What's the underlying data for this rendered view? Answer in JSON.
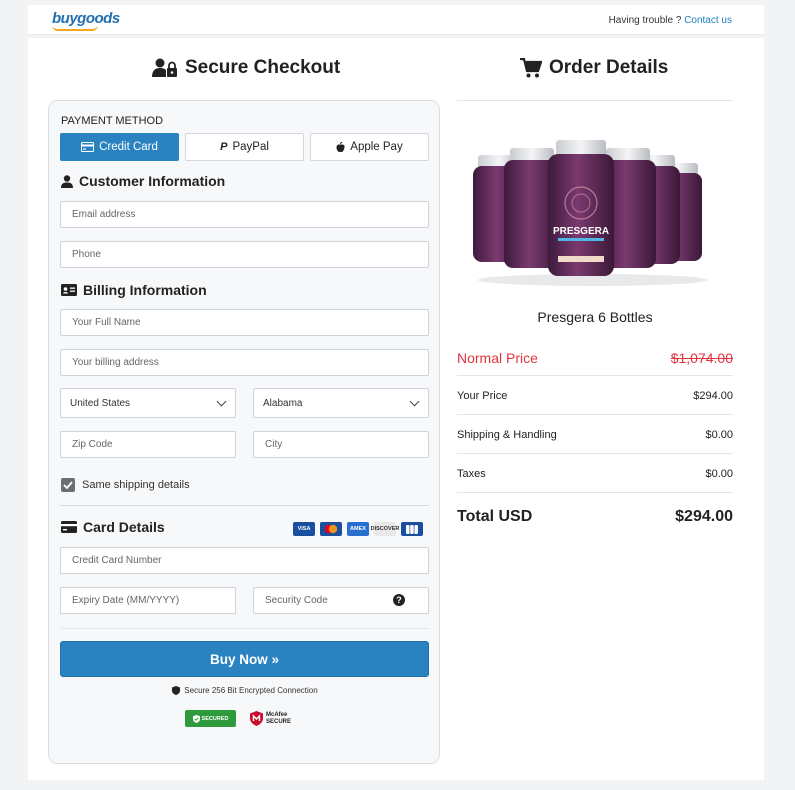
{
  "header": {
    "logo_text": "buygoods",
    "trouble_text": "Having trouble ?",
    "contact_link": "Contact us"
  },
  "checkout": {
    "title": "Secure Checkout",
    "payment_method_label": "PAYMENT METHOD",
    "tabs": [
      {
        "label": "Credit Card",
        "icon": "credit-card-icon",
        "active": true
      },
      {
        "label": "PayPal",
        "icon": "paypal-icon",
        "active": false
      },
      {
        "label": "Apple Pay",
        "icon": "apple-icon",
        "active": false
      }
    ],
    "customer_info": {
      "title": "Customer Information",
      "email_placeholder": "Email address",
      "phone_placeholder": "Phone"
    },
    "billing_info": {
      "title": "Billing Information",
      "name_placeholder": "Your Full Name",
      "address_placeholder": "Your billing address",
      "country_value": "United States",
      "state_value": "Alabama",
      "zip_placeholder": "Zip Code",
      "city_placeholder": "City",
      "same_shipping_label": "Same shipping details",
      "same_shipping_checked": true
    },
    "card_details": {
      "title": "Card Details",
      "card_brands": [
        "VISA",
        "mastercard",
        "AMEX",
        "DISCOVER",
        "jcb"
      ],
      "number_placeholder": "Credit Card Number",
      "expiry_placeholder": "Expiry Date (MM/YYYY)",
      "cvv_placeholder": "Security Code"
    },
    "buy_button": "Buy Now »",
    "secure_text": "Secure 256 Bit Encrypted Connection",
    "badge_secured": "SECURED",
    "badge_mcafee_top": "McAfee",
    "badge_mcafee_bottom": "SECURE"
  },
  "order": {
    "title": "Order Details",
    "product_name": "Presgera 6 Bottles",
    "product_label": "PRESGERA",
    "rows": [
      {
        "label": "Normal Price",
        "value": "$1,074.00"
      },
      {
        "label": "Your Price",
        "value": "$294.00"
      },
      {
        "label": "Shipping & Handling",
        "value": "$0.00"
      },
      {
        "label": "Taxes",
        "value": "$0.00"
      }
    ],
    "total_label": "Total USD",
    "total_value": "$294.00"
  },
  "colors": {
    "accent": "#2a82c0",
    "normal_price": "#e0343f",
    "bottle_purple": "#5a2a57"
  }
}
